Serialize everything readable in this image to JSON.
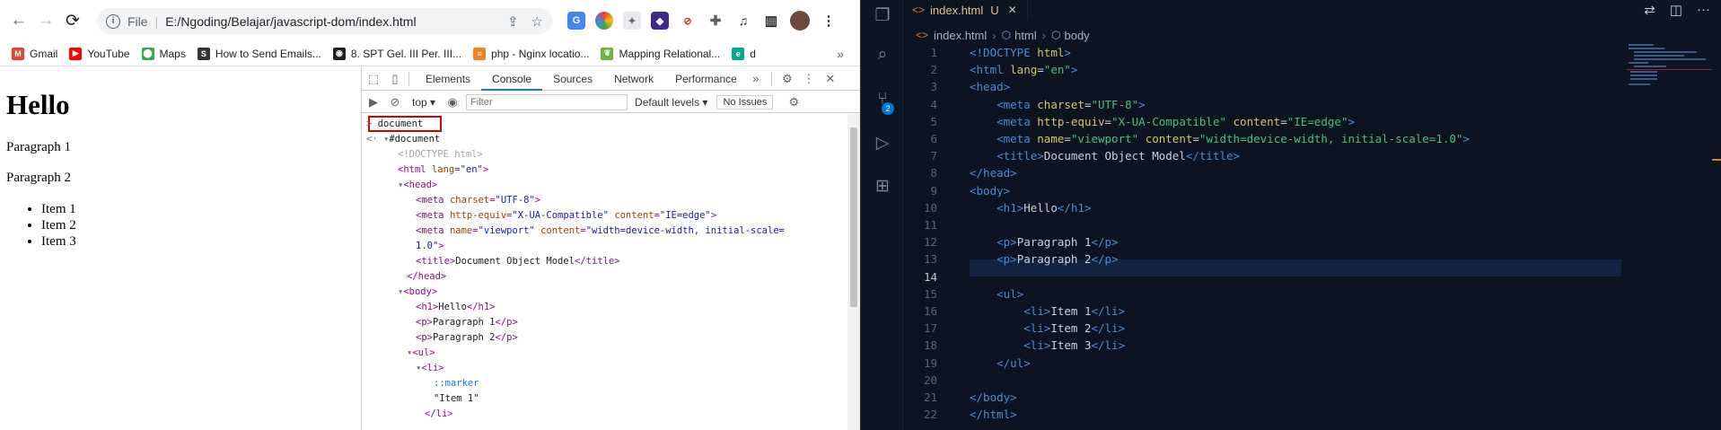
{
  "browser": {
    "url_scheme": "File",
    "url_path": "E:/Ngoding/Belajar/javascript-dom/index.html",
    "bookmarks": [
      {
        "label": "Gmail",
        "icon": "gmail-icon",
        "color": "#ea4335",
        "glyph": "M"
      },
      {
        "label": "YouTube",
        "icon": "youtube-icon",
        "color": "#ff0000",
        "glyph": "▶"
      },
      {
        "label": "Maps",
        "icon": "maps-icon",
        "color": "#34a853",
        "glyph": "⬤"
      },
      {
        "label": "How to Send Emails...",
        "icon": "site-icon",
        "color": "#333333",
        "glyph": "S"
      },
      {
        "label": "8. SPT Gel. III Per. III...",
        "icon": "globe-icon",
        "color": "#202124",
        "glyph": "◉"
      },
      {
        "label": "php - Nginx locatio...",
        "icon": "stackoverflow-icon",
        "color": "#f48024",
        "glyph": "≡"
      },
      {
        "label": "Mapping Relational...",
        "icon": "leaf-icon",
        "color": "#6db33f",
        "glyph": "❦"
      },
      {
        "label": "d",
        "icon": "dcode-icon",
        "color": "#00a98f",
        "glyph": "e"
      }
    ]
  },
  "page": {
    "heading": "Hello",
    "paragraphs": [
      "Paragraph 1",
      "Paragraph 2"
    ],
    "items": [
      "Item 1",
      "Item 2",
      "Item 3"
    ]
  },
  "devtools": {
    "tabs": [
      "Elements",
      "Console",
      "Sources",
      "Network",
      "Performance"
    ],
    "active_tab": "Console",
    "context": "top",
    "filter_placeholder": "Filter",
    "levels": "Default levels",
    "issues": "No Issues",
    "command": "document",
    "output_root": "#document"
  },
  "vscode": {
    "tab_name": "index.html",
    "tab_status": "U",
    "breadcrumb": [
      "index.html",
      "html",
      "body"
    ],
    "scm_badge": "2",
    "current_line": 14,
    "colors": {
      "tag": "#4f8ad6",
      "attr": "#d6c26a",
      "value": "#4cc07a",
      "text": "#c9d1db"
    }
  }
}
